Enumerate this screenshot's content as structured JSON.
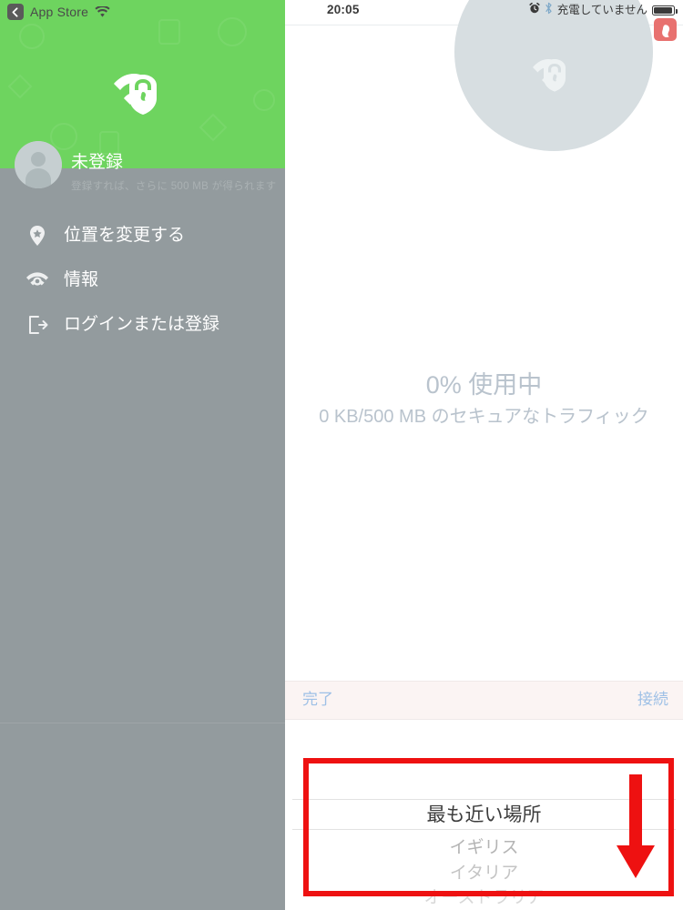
{
  "drawer": {
    "status": {
      "back_app_label": "App Store",
      "back_icon": "back-chevron-icon",
      "wifi_icon": "wifi-icon"
    },
    "logo_icon": "avira-phantom-vpn-shield-logo",
    "profile": {
      "avatar_icon": "person-avatar-icon",
      "name": "未登録",
      "subtitle": "登録すれば、さらに 500 MB が得られます"
    },
    "items": [
      {
        "label": "位置を変更する",
        "icon": "location-pin-star-icon"
      },
      {
        "label": "情報",
        "icon": "phantom-wifi-info-icon"
      },
      {
        "label": "ログインまたは登録",
        "icon": "login-exit-arrow-icon"
      }
    ],
    "background_color": "#939b9e",
    "header_color": "#6ed45f"
  },
  "panel": {
    "statusbar": {
      "time": "20:05",
      "alarm_icon": "alarm-clock-icon",
      "bluetooth_icon": "bluetooth-icon",
      "charging_text": "充電していません",
      "battery_icon": "battery-icon"
    },
    "app_badge": {
      "icon": "avira-umbrella-a-icon",
      "color": "#e8716f"
    },
    "hero": {
      "circle_color": "#d7dee1",
      "logo_icon": "avira-phantom-vpn-shield-logo"
    },
    "usage": {
      "percent_text": "0% 使用中",
      "detail_text": "0 KB/500 MB のセキュアなトラフィック"
    },
    "toolbar": {
      "done_label": "完了",
      "connect_label": "接続",
      "link_color": "#9ec0e6"
    },
    "picker": {
      "selected": "最も近い場所",
      "options": [
        "イギリス",
        "イタリア",
        "オーストラリア"
      ]
    }
  },
  "annotations": {
    "highlight_box": {
      "color": "#ee1111"
    },
    "down_arrow": {
      "color": "#ee1111",
      "icon": "down-arrow-annotation-icon"
    }
  }
}
